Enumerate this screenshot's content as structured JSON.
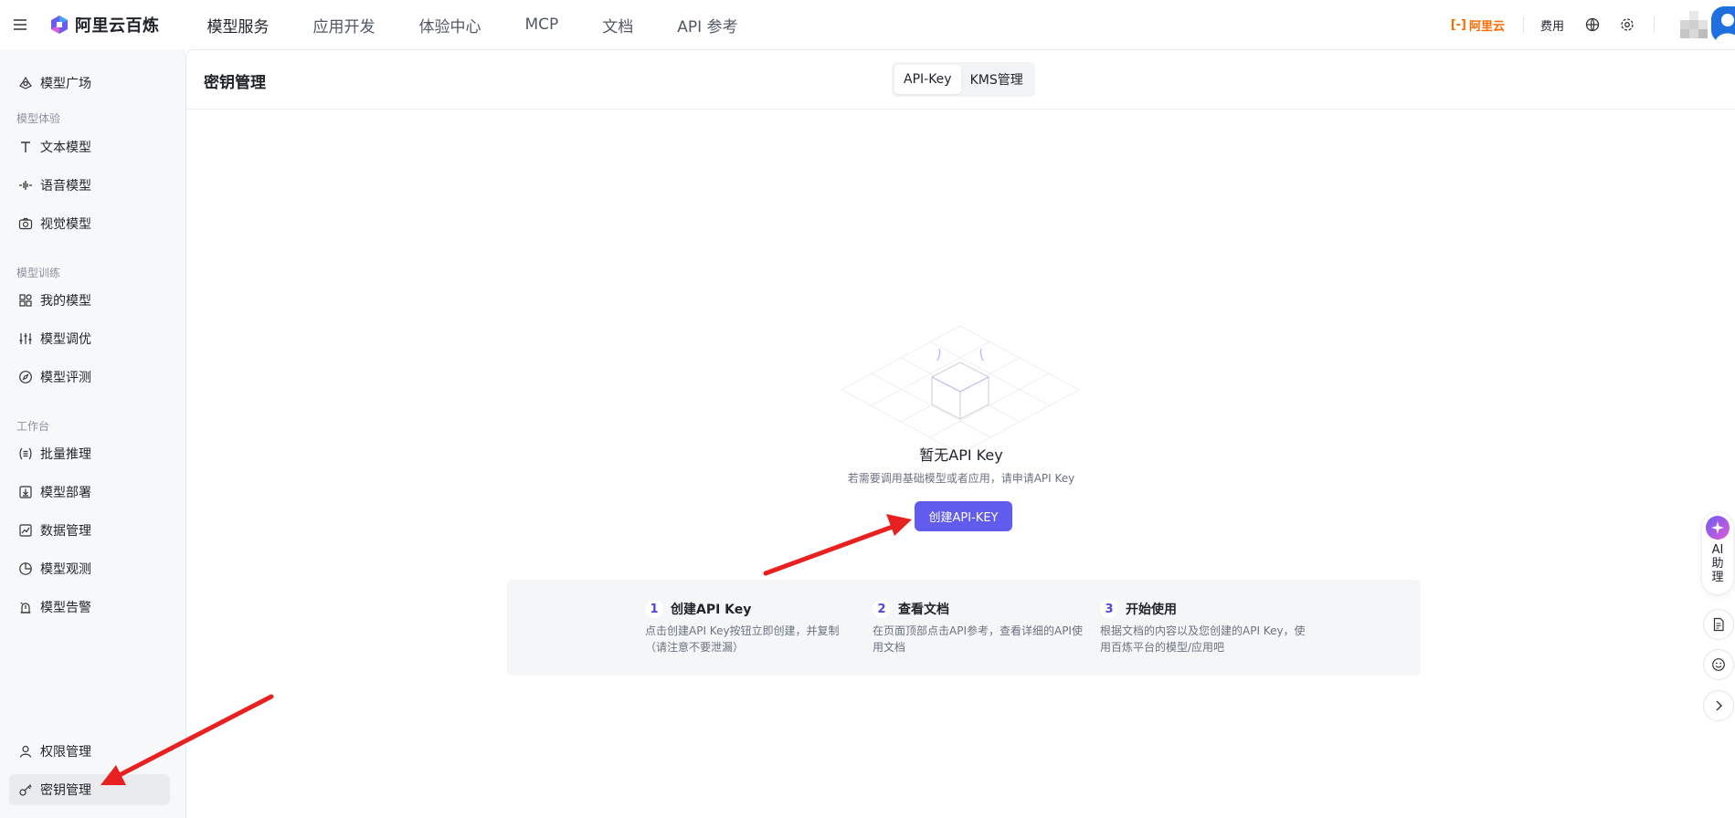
{
  "topbar": {
    "brand": "阿里云百炼",
    "nav": [
      "模型服务",
      "应用开发",
      "体验中心",
      "MCP",
      "文档",
      "API 参考"
    ],
    "aliyun_label": "阿里云",
    "fee_label": "费用"
  },
  "sidebar": {
    "top_item": "模型广场",
    "groups": {
      "experience": "模型体验",
      "training": "模型训练",
      "workbench": "工作台"
    },
    "experience_items": [
      "文本模型",
      "语音模型",
      "视觉模型"
    ],
    "training_items": [
      "我的模型",
      "模型调优",
      "模型评测"
    ],
    "workbench_items": [
      "批量推理",
      "模型部署",
      "数据管理",
      "模型观测",
      "模型告警"
    ],
    "bottom_items": [
      "权限管理",
      "密钥管理"
    ]
  },
  "main": {
    "title": "密钥管理",
    "tabs": [
      "API-Key",
      "KMS管理"
    ],
    "empty_title": "暂无API Key",
    "empty_desc": "若需要调用基础模型或者应用，请申请API Key",
    "create_button": "创建API-KEY",
    "steps": [
      {
        "num": "1",
        "title": "创建API Key",
        "desc": "点击创建API Key按钮立即创建，并复制（请注意不要泄漏）"
      },
      {
        "num": "2",
        "title": "查看文档",
        "desc": "在页面顶部点击API参考，查看详细的API使用文档"
      },
      {
        "num": "3",
        "title": "开始使用",
        "desc": "根据文档的内容以及您创建的API Key，使用百炼平台的模型/应用吧"
      }
    ]
  },
  "float": {
    "ai_label": "AI助理"
  },
  "colors": {
    "accent": "#615ced",
    "aliyun_orange": "#ff6a00",
    "annotation_arrow": "#e8201f"
  }
}
